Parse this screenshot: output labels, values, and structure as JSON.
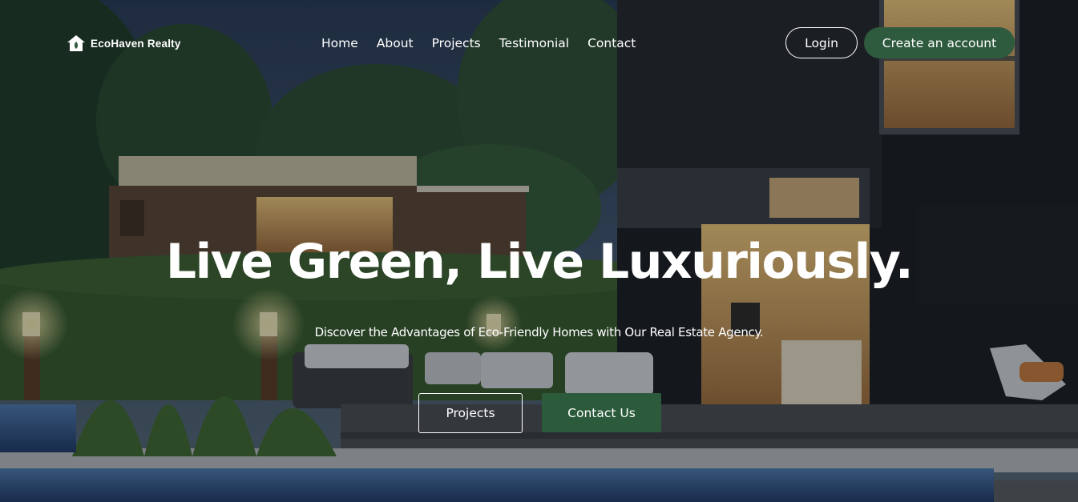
{
  "brand": {
    "name": "EcoHaven Realty",
    "logo_icon": "house-icon"
  },
  "nav": {
    "items": [
      {
        "label": "Home"
      },
      {
        "label": "About"
      },
      {
        "label": "Projects"
      },
      {
        "label": "Testimonial"
      },
      {
        "label": "Contact"
      }
    ]
  },
  "auth": {
    "login_label": "Login",
    "create_label": "Create an account"
  },
  "hero": {
    "headline": "Live Green, Live Luxuriously.",
    "subheadline": "Discover the Advantages of Eco-Friendly Homes with Our Real Estate Agency.",
    "primary_cta": "Projects",
    "secondary_cta": "Contact Us"
  },
  "colors": {
    "accent_green": "#2e5a3e",
    "text": "#ffffff"
  }
}
